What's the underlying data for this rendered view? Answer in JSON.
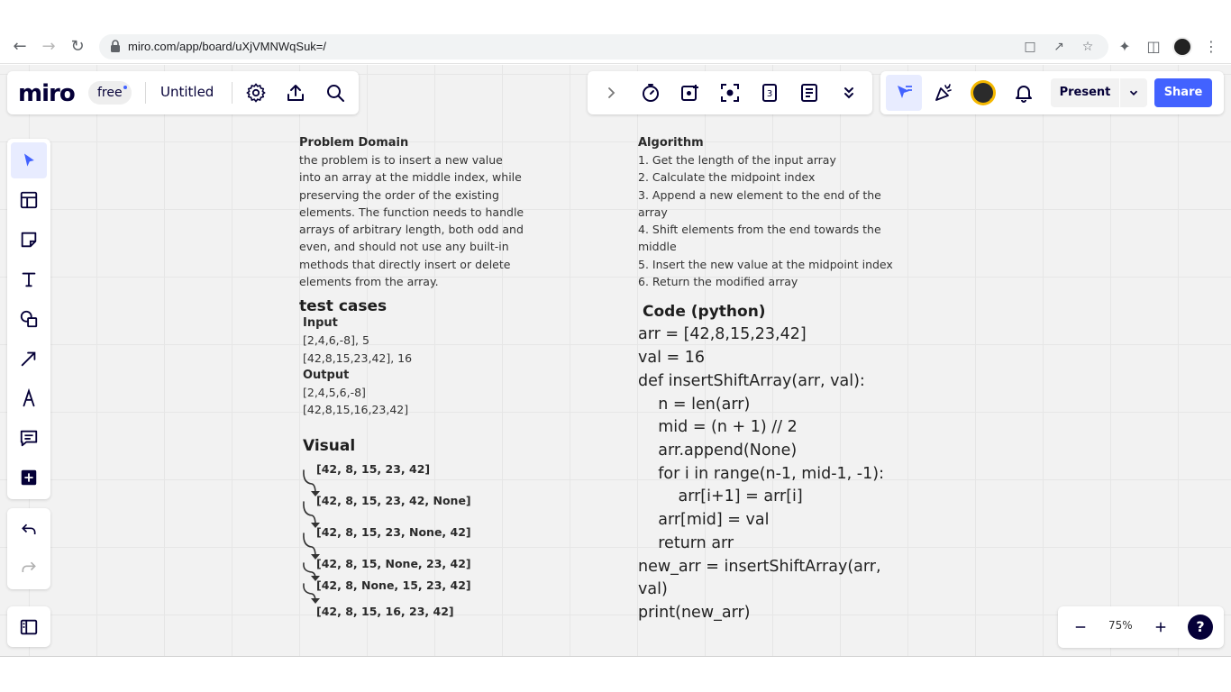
{
  "browser": {
    "url": "miro.com/app/board/uXjVMNWqSuk=/"
  },
  "miro": {
    "logo": "miro",
    "plan": "free",
    "board_title": "Untitled",
    "present_label": "Present",
    "share_label": "Share",
    "zoom": "75%",
    "help": "?"
  },
  "problem": {
    "heading": "Problem Domain",
    "lines": [
      "the problem is to insert a new value",
      "into an array at the middle index, while",
      "preserving the order of the existing",
      "elements. The function needs to handle",
      "arrays of arbitrary length, both odd and",
      "even, and should not use any built-in",
      "methods that directly insert or delete",
      "elements from the array."
    ]
  },
  "tests": {
    "heading": "test cases",
    "input_label": "Input",
    "inputs": [
      "[2,4,6,-8], 5",
      "[42,8,15,23,42], 16"
    ],
    "output_label": "Output",
    "outputs": [
      "[2,4,5,6,-8]",
      "[42,8,15,16,23,42]"
    ]
  },
  "visual": {
    "heading": "Visual",
    "steps": [
      "[42, 8, 15, 23, 42]",
      "[42, 8, 15, 23, 42, None]",
      "[42, 8, 15, 23, None, 42]",
      "[42, 8, 15, None, 23, 42]",
      "[42, 8, None, 15, 23, 42]",
      "[42, 8, 15, 16, 23, 42]"
    ]
  },
  "algorithm": {
    "heading": "Algorithm",
    "lines": [
      "1. Get the length of the input array",
      "2. Calculate the midpoint index",
      "3. Append a new element to the end of the",
      "array",
      "4. Shift elements from the end towards the",
      "middle",
      "5. Insert the new value at the midpoint index",
      "6. Return the modified array"
    ]
  },
  "code": {
    "heading": "Code (python)",
    "lines": [
      "arr = [42,8,15,23,42]",
      "val = 16",
      "def insertShiftArray(arr, val):",
      "    n = len(arr)",
      "    mid = (n + 1) // 2",
      "    arr.append(None)",
      "    for i in range(n-1, mid-1, -1):",
      "        arr[i+1] = arr[i]",
      "    arr[mid] = val",
      "    return arr",
      "new_arr = insertShiftArray(arr,",
      "val)",
      "print(new_arr)"
    ]
  },
  "colors": {
    "accent": "#4262ff",
    "board_bg": "#f2f2f2",
    "logo": "#050038"
  }
}
